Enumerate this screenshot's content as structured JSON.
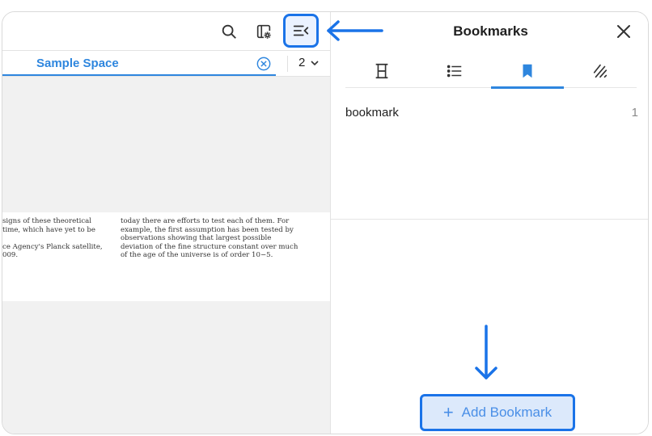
{
  "toolbar": {
    "icons": [
      "search-icon",
      "settings-icon",
      "panel-toggle-icon"
    ]
  },
  "search": {
    "query": "Sample Space",
    "page_number": "2"
  },
  "document": {
    "column1": [
      "signs of these theoretical",
      "time, which have yet to be",
      "",
      "ce Agency's Planck satellite,",
      "009."
    ],
    "column2": [
      "today there are efforts to test each of them. For",
      "example, the first assumption has been tested by",
      "observations showing that largest possible",
      "deviation of the fine structure constant over much",
      "of the age of the universe is of order 10−5."
    ]
  },
  "bookmarks_panel": {
    "title": "Bookmarks",
    "tabs": [
      "headings-icon",
      "outline-list-icon",
      "bookmark-icon",
      "annotations-icon"
    ],
    "active_tab": "bookmark-icon",
    "items": [
      {
        "label": "bookmark",
        "page": "1"
      }
    ],
    "add_button_label": "Add Bookmark"
  },
  "colors": {
    "accent": "#2e86de",
    "highlight_border": "#1a73e8",
    "add_button_bg": "#dce9fb"
  }
}
